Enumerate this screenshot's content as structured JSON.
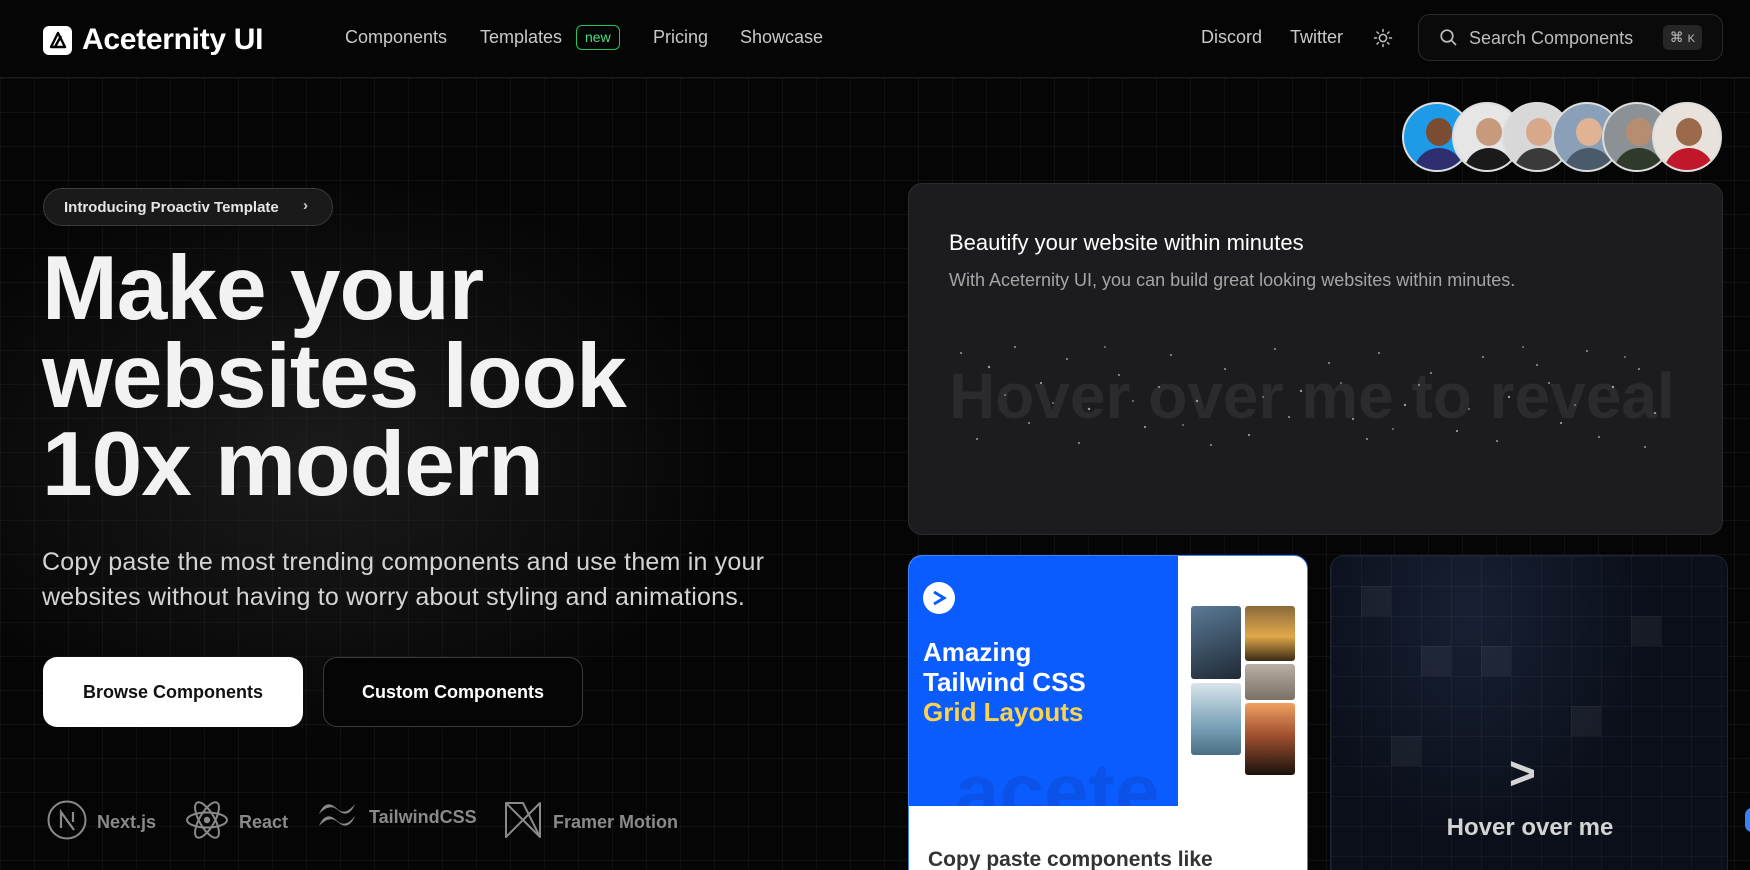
{
  "brand": {
    "name": "Aceternity UI"
  },
  "nav": {
    "components": "Components",
    "templates": "Templates",
    "templates_badge": "new",
    "pricing": "Pricing",
    "showcase": "Showcase",
    "discord": "Discord",
    "twitter": "Twitter"
  },
  "search": {
    "placeholder": "Search Components",
    "shortcut_symbol": "⌘",
    "shortcut_key": "K"
  },
  "hero": {
    "announcement": "Introducing Proactiv Template",
    "announcement_chevron": "›",
    "headline_line1": "Make your",
    "headline_line2": "websites look",
    "headline_line3": "10x modern",
    "subtext_line1": "Copy paste the most trending components and use them in your",
    "subtext_line2": "websites without having to worry about styling and animations.",
    "primary_cta": "Browse Components",
    "secondary_cta": "Custom Components"
  },
  "tech_stack": [
    "Next.js",
    "React",
    "TailwindCSS",
    "Framer Motion"
  ],
  "reveal_card": {
    "title": "Beautify your website within minutes",
    "description": "With Aceternity UI, you can build great looking websites within minutes.",
    "reveal_text": "Hover over me to reveal"
  },
  "blue_card": {
    "title_line1": "Amazing",
    "title_line2": "Tailwind CSS",
    "title_line3": "Grid Layouts",
    "ghost_text": "acete",
    "caption": "Copy paste components like"
  },
  "hover_card": {
    "chevron": ">",
    "label": "Hover over me"
  },
  "colors": {
    "accent_blue": "#0b5cff",
    "accent_yellow": "#fcd34d",
    "badge_green": "#22c55e",
    "background": "#050505"
  },
  "icons": [
    "logo-icon",
    "sun-icon",
    "search-icon",
    "nextjs-icon",
    "react-icon",
    "tailwind-icon",
    "framer-icon"
  ]
}
